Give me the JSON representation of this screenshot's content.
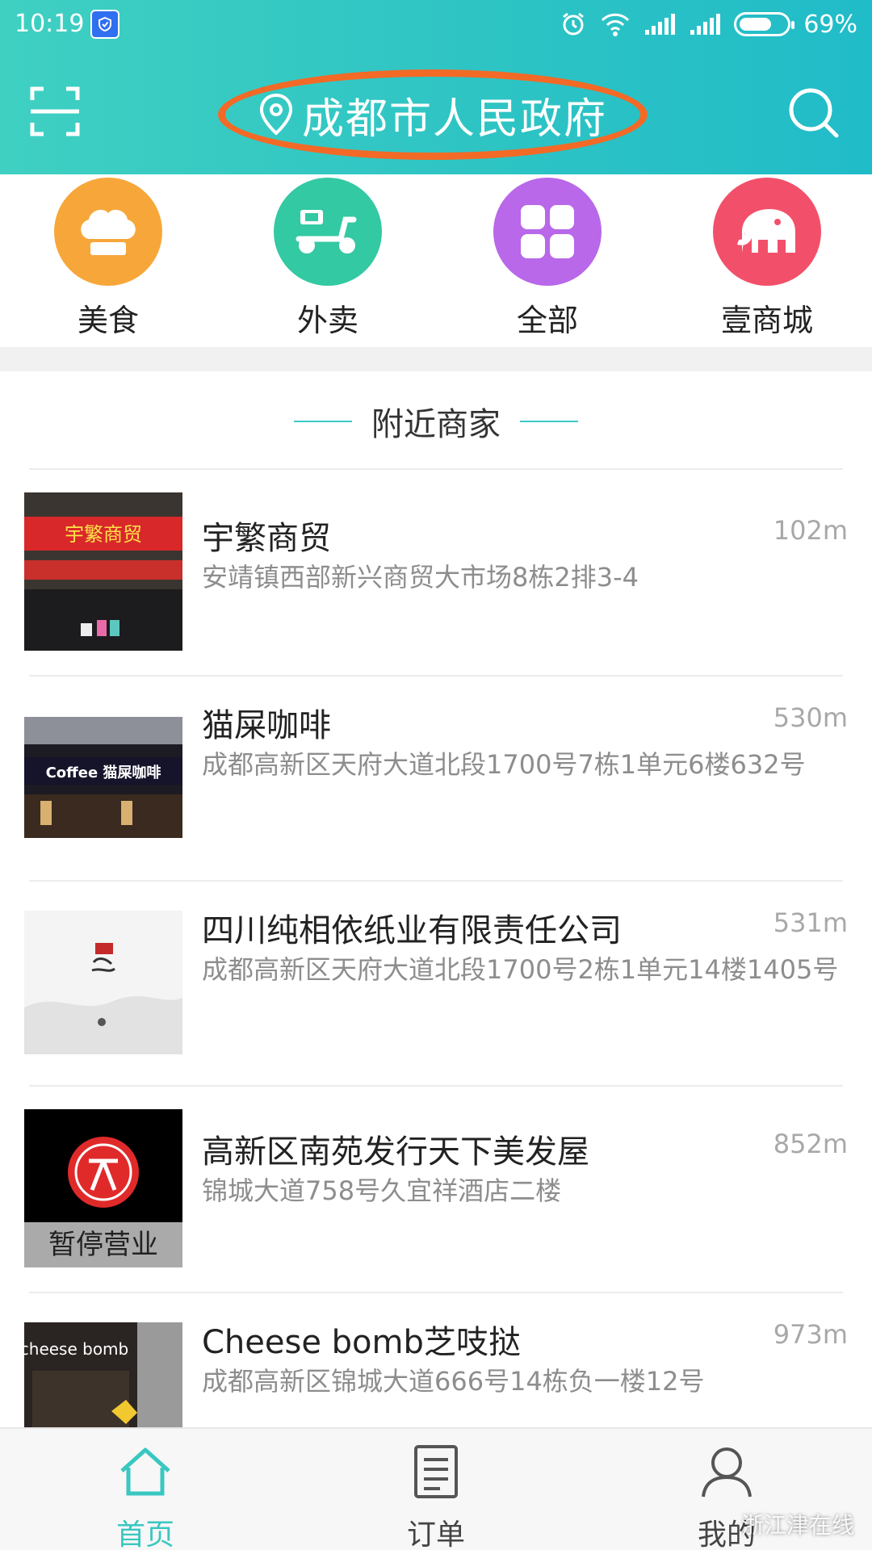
{
  "status_bar": {
    "time": "10:19",
    "battery": "69%",
    "battery_level": 0.69
  },
  "header": {
    "location": "成都市人民政府"
  },
  "categories": [
    {
      "label": "美食",
      "icon": "chef-hat-icon",
      "color": "#f7a73a"
    },
    {
      "label": "外卖",
      "icon": "scooter-icon",
      "color": "#33c9a2"
    },
    {
      "label": "全部",
      "icon": "grid-icon",
      "color": "#b868e8"
    },
    {
      "label": "壹商城",
      "icon": "elephant-icon",
      "color": "#f2506a"
    }
  ],
  "section": {
    "title": "附近商家"
  },
  "merchants": [
    {
      "name": "宇繁商贸",
      "distance": "102m",
      "address": "安靖镇西部新兴商贸大市场8栋2排3-4",
      "sign_text": "宇繁商贸"
    },
    {
      "name": "猫屎咖啡",
      "distance": "530m",
      "address": "成都高新区天府大道北段1700号7栋1单元6楼632号",
      "sign_text": "Coffee 猫屎咖啡"
    },
    {
      "name": "四川纯相依纸业有限责任公司",
      "distance": "531m",
      "address": "成都高新区天府大道北段1700号2栋1单元14楼1405号"
    },
    {
      "name": "高新区南苑发行天下美发屋",
      "distance": "852m",
      "address": "锦城大道758号久宜祥酒店二楼",
      "status": "暂停营业"
    },
    {
      "name": "Cheese bomb芝吱挞",
      "distance": "973m",
      "address": "成都高新区锦城大道666号14栋负一楼12号",
      "sign_text": "cheese bomb"
    }
  ],
  "bottom_nav": [
    {
      "label": "首页",
      "icon": "home-icon",
      "active": true
    },
    {
      "label": "订单",
      "icon": "order-list-icon",
      "active": false
    },
    {
      "label": "我的",
      "icon": "user-icon",
      "active": false
    }
  ],
  "watermark": "浙江津在线",
  "colors": {
    "header": "#2ec4c4",
    "accent": "#39c7c1",
    "highlight_ring": "#f26a26"
  }
}
